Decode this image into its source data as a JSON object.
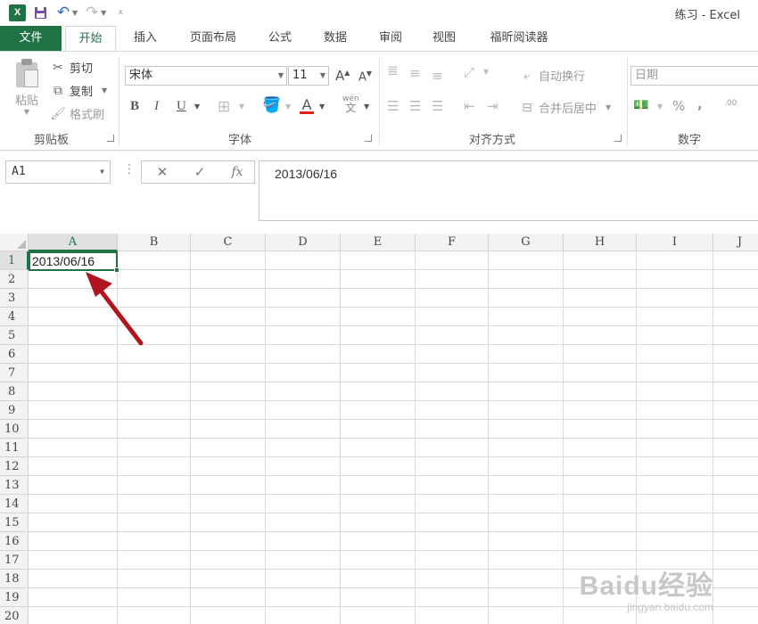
{
  "app": {
    "window_title": "练习 - Excel",
    "logo": "X",
    "qat": [
      {
        "name": "save-icon",
        "glyph": "💾"
      },
      {
        "name": "undo-icon",
        "glyph": "↶"
      },
      {
        "name": "redo-icon",
        "glyph": "↷"
      },
      {
        "name": "customize-icon",
        "glyph": "≡"
      }
    ]
  },
  "tabs": [
    "文件",
    "开始",
    "插入",
    "页面布局",
    "公式",
    "数据",
    "审阅",
    "视图",
    "福昕阅读器"
  ],
  "ribbon": {
    "clipboard": {
      "paste": "粘贴",
      "cut": "剪切",
      "copy": "复制",
      "format_painter": "格式刷",
      "label": "剪贴板"
    },
    "font": {
      "font_name": "宋体",
      "font_size": "11",
      "grow": "A",
      "shrink": "A",
      "bold": "B",
      "italic": "I",
      "underline": "U",
      "font_color": "A",
      "phonetic": "wén",
      "phonetic_char": "文",
      "label": "字体"
    },
    "alignment": {
      "wrap_text": "自动换行",
      "merge_center": "合并后居中",
      "label": "对齐方式"
    },
    "number": {
      "format": "日期",
      "percent": "%",
      "comma": ",",
      "inc_decimal": ".00",
      "label": "数字"
    }
  },
  "formula_bar": {
    "name_box": "A1",
    "cancel": "✕",
    "enter": "✓",
    "fx": "fx",
    "value": "2013/06/16"
  },
  "sheet": {
    "columns": [
      "A",
      "B",
      "C",
      "D",
      "E",
      "F",
      "G",
      "H",
      "I",
      "J"
    ],
    "rows": [
      "1",
      "2",
      "3",
      "4",
      "5",
      "6",
      "7",
      "8",
      "9",
      "10",
      "11",
      "12",
      "13",
      "14",
      "15",
      "16",
      "17",
      "18",
      "19",
      "20"
    ],
    "selected_column": "A",
    "selected_row": "1",
    "active_cell_value": "2013/06/16"
  },
  "annotation": {
    "color": "#b0141e"
  },
  "watermark": {
    "main": "Baidu经验",
    "sub": "jingyan.baidu.com"
  },
  "colors": {
    "accent": "#217346"
  }
}
